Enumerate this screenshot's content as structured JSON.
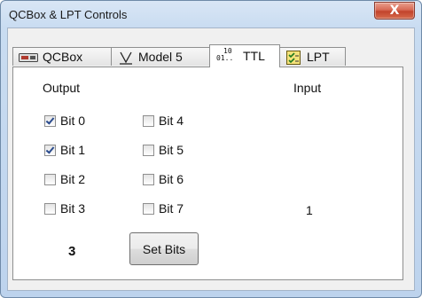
{
  "window": {
    "title": "QCBox & LPT Controls",
    "close_label": "X"
  },
  "tabs": [
    {
      "label": "QCBox",
      "icon": "card-icon"
    },
    {
      "label": "Model 5",
      "icon": "underlined-v-icon"
    },
    {
      "label": "TTL",
      "icon": "binary-digits-icon",
      "icon_text_top": "10",
      "icon_text_bottom": "01.."
    },
    {
      "label": "LPT",
      "icon": "checkbox-list-icon"
    }
  ],
  "active_tab": "TTL",
  "output": {
    "heading": "Output",
    "bits": [
      {
        "label": "Bit 0",
        "checked": true
      },
      {
        "label": "Bit 1",
        "checked": true
      },
      {
        "label": "Bit 2",
        "checked": false
      },
      {
        "label": "Bit 3",
        "checked": false
      },
      {
        "label": "Bit 4",
        "checked": false
      },
      {
        "label": "Bit 5",
        "checked": false
      },
      {
        "label": "Bit 6",
        "checked": false
      },
      {
        "label": "Bit 7",
        "checked": false
      }
    ],
    "value": "3",
    "set_bits_label": "Set Bits"
  },
  "input": {
    "heading": "Input",
    "value": "1"
  },
  "colors": {
    "checkmark": "#2a4b8d",
    "frame_border": "#6f8aa8",
    "close_red": "#c2432c"
  }
}
